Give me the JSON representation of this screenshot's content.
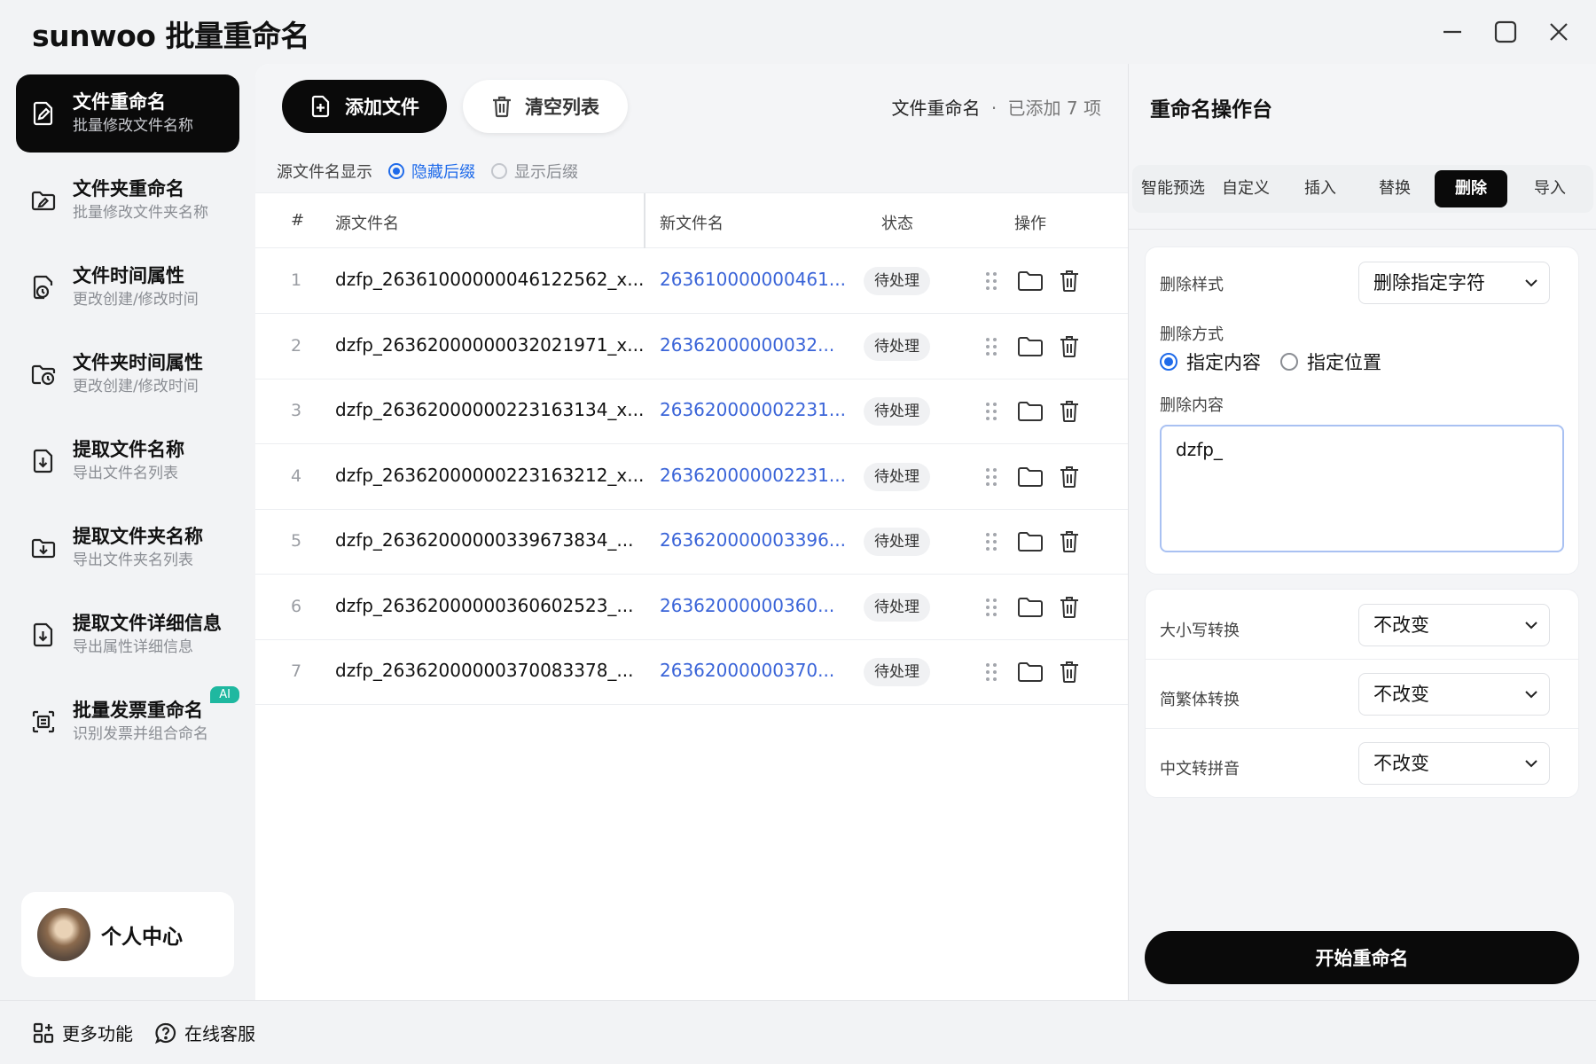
{
  "app": {
    "title": "sunwoo 批量重命名",
    "window_controls": [
      "minimize-icon",
      "maximize-icon",
      "close-icon"
    ]
  },
  "sidebar": {
    "items": [
      {
        "label": "文件重命名",
        "sub": "批量修改文件名称",
        "icon": "file-rename-icon",
        "active": true
      },
      {
        "label": "文件夹重命名",
        "sub": "批量修改文件夹名称",
        "icon": "folder-rename-icon"
      },
      {
        "label": "文件时间属性",
        "sub": "更改创建/修改时间",
        "icon": "file-clock-icon"
      },
      {
        "label": "文件夹时间属性",
        "sub": "更改创建/修改时间",
        "icon": "folder-clock-icon"
      },
      {
        "label": "提取文件名称",
        "sub": "导出文件名列表",
        "icon": "file-export-icon"
      },
      {
        "label": "提取文件夹名称",
        "sub": "导出文件夹名列表",
        "icon": "folder-export-icon"
      },
      {
        "label": "提取文件详细信息",
        "sub": "导出属性详细信息",
        "icon": "file-detail-export-icon"
      },
      {
        "label": "批量发票重命名",
        "sub": "识别发票并组合命名",
        "icon": "invoice-scan-icon",
        "badge": "AI"
      }
    ],
    "profile": {
      "label": "个人中心"
    }
  },
  "bottom": {
    "more": "更多功能",
    "support": "在线客服"
  },
  "toolbar": {
    "add_label": "添加文件",
    "clear_label": "清空列表",
    "mode": "文件重命名",
    "dot": "·",
    "count": "已添加 7 项"
  },
  "display": {
    "label": "源文件名显示",
    "hide_ext": "隐藏后缀",
    "show_ext": "显示后缀",
    "selected": "hide"
  },
  "table": {
    "headers": {
      "num": "#",
      "src": "源文件名",
      "dst": "新文件名",
      "status": "状态",
      "ops": "操作"
    },
    "rows": [
      {
        "num": "1",
        "src": "dzfp_26361000000046122562_x...",
        "dst": "263610000000461...",
        "status": "待处理"
      },
      {
        "num": "2",
        "src": "dzfp_26362000000032021971_x...",
        "dst": "26362000000032...",
        "status": "待处理"
      },
      {
        "num": "3",
        "src": "dzfp_26362000000223163134_x...",
        "dst": "263620000002231...",
        "status": "待处理"
      },
      {
        "num": "4",
        "src": "dzfp_26362000000223163212_x...",
        "dst": "263620000002231...",
        "status": "待处理"
      },
      {
        "num": "5",
        "src": "dzfp_26362000000339673834_...",
        "dst": "263620000003396...",
        "status": "待处理"
      },
      {
        "num": "6",
        "src": "dzfp_26362000000360602523_...",
        "dst": "26362000000360...",
        "status": "待处理"
      },
      {
        "num": "7",
        "src": "dzfp_26362000000370083378_...",
        "dst": "26362000000370...",
        "status": "待处理"
      }
    ]
  },
  "panel": {
    "title": "重命名操作台",
    "tabs": [
      "智能预选",
      "自定义",
      "插入",
      "替换",
      "删除",
      "导入"
    ],
    "active_tab": "删除",
    "delete_style_label": "删除样式",
    "delete_style_value": "删除指定字符",
    "delete_mode_label": "删除方式",
    "mode_content": "指定内容",
    "mode_position": "指定位置",
    "delete_content_label": "删除内容",
    "delete_content_value": "dzfp_",
    "case_label": "大小写转换",
    "case_value": "不改变",
    "trad_label": "简繁体转换",
    "trad_value": "不改变",
    "pinyin_label": "中文转拼音",
    "pinyin_value": "不改变",
    "start_label": "开始重命名"
  },
  "colors": {
    "accent": "#1f6bea",
    "link": "#3a64d8",
    "dark": "#0a0a0a",
    "ai_badge": "#1fb8a0"
  }
}
